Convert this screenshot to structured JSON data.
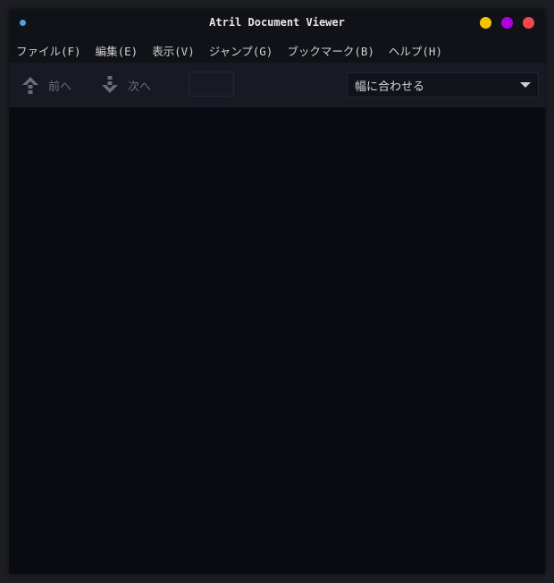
{
  "window": {
    "title": "Atril Document Viewer",
    "colors": {
      "title_dot": "#4aa4e4",
      "minimize": "#f5c400",
      "maximize": "#b000e0",
      "close": "#f0484d"
    }
  },
  "menubar": {
    "items": [
      {
        "label": "ファイル(F)"
      },
      {
        "label": "編集(E)"
      },
      {
        "label": "表示(V)"
      },
      {
        "label": "ジャンプ(G)"
      },
      {
        "label": "ブックマーク(B)"
      },
      {
        "label": "ヘルプ(H)"
      }
    ]
  },
  "toolbar": {
    "prev_label": "前へ",
    "prev_icon": "go-up-icon",
    "next_label": "次へ",
    "next_icon": "go-down-icon",
    "page_entry_value": "",
    "zoom": {
      "selected": "幅に合わせる"
    }
  }
}
